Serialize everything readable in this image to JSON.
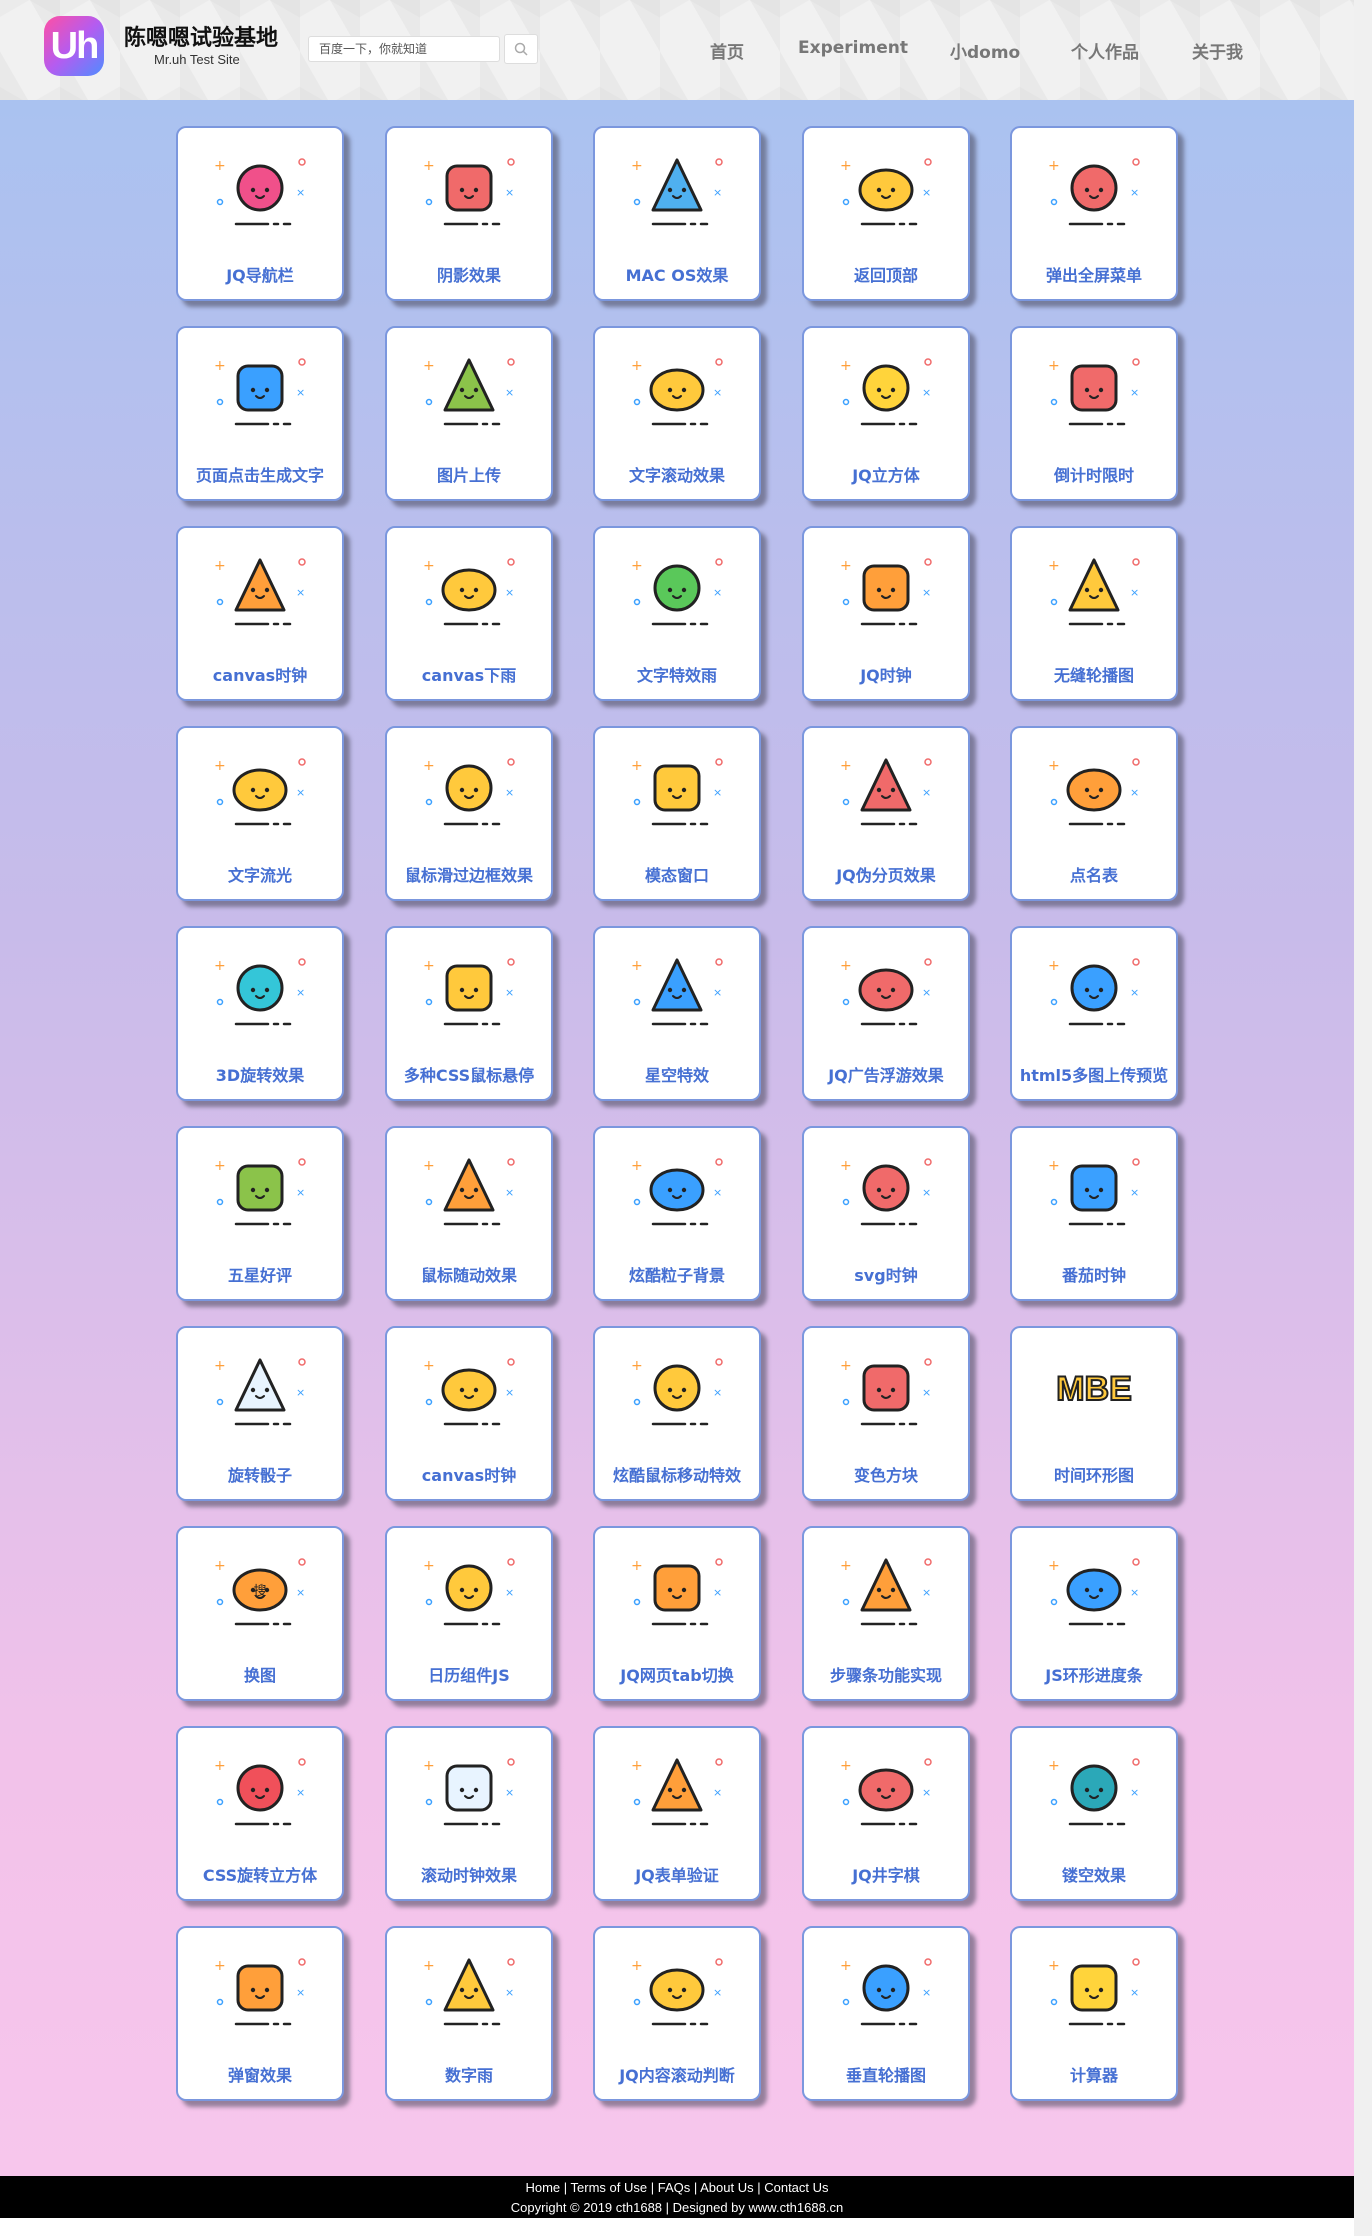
{
  "header": {
    "logo_text": "Uh",
    "site_title": "陈嗯嗯试验基地",
    "site_subtitle": "Mr.uh Test Site",
    "search_placeholder": "百度一下，你就知道",
    "nav": [
      "首页",
      "Experiment",
      "小domo",
      "个人作品",
      "关于我"
    ]
  },
  "cards": [
    {
      "label": "JQ导航栏",
      "icon": "gear-icon",
      "color": "#f0508a"
    },
    {
      "label": "阴影效果",
      "icon": "lock-icon",
      "color": "#f06a6a"
    },
    {
      "label": "MAC OS效果",
      "icon": "ghosts-icon",
      "color": "#4fb0f0"
    },
    {
      "label": "返回顶部",
      "icon": "chat-bubbles-icon",
      "color": "#ffc93c"
    },
    {
      "label": "弹出全屏菜单",
      "icon": "hat-icon",
      "color": "#f06a6a"
    },
    {
      "label": "页面点击生成文字",
      "icon": "speech-bubble-icon",
      "color": "#3aa0ff"
    },
    {
      "label": "图片上传",
      "icon": "shield-icon",
      "color": "#8bc34a"
    },
    {
      "label": "文字滚动效果",
      "icon": "fire-icon",
      "color": "#ffc93c"
    },
    {
      "label": "JQ立方体",
      "icon": "lightning-icon",
      "color": "#ffd43b"
    },
    {
      "label": "倒计时限时",
      "icon": "money-bag-icon",
      "color": "#f06a6a"
    },
    {
      "label": "canvas时钟",
      "icon": "blob-face-icon",
      "color": "#ff9f3a"
    },
    {
      "label": "canvas下雨",
      "icon": "bear-icon",
      "color": "#ffc93c"
    },
    {
      "label": "文字特效雨",
      "icon": "gift-icon",
      "color": "#5ac85a"
    },
    {
      "label": "JQ时钟",
      "icon": "hand-truck-icon",
      "color": "#ff9f3a"
    },
    {
      "label": "无缝轮播图",
      "icon": "truck-icon",
      "color": "#ffc93c"
    },
    {
      "label": "文字流光",
      "icon": "star-icon",
      "color": "#ffc93c"
    },
    {
      "label": "鼠标滑过边框效果",
      "icon": "beer-mug-icon",
      "color": "#ffc93c"
    },
    {
      "label": "模态窗口",
      "icon": "gameboy-icon",
      "color": "#ffc93c"
    },
    {
      "label": "JQ伪分页效果",
      "icon": "bell-icon",
      "color": "#f06a6a"
    },
    {
      "label": "点名表",
      "icon": "box-arrow-icon",
      "color": "#ff9f3a"
    },
    {
      "label": "3D旋转效果",
      "icon": "bell-icon",
      "color": "#34c6d8"
    },
    {
      "label": "多种CSS鼠标悬停",
      "icon": "bell-icon",
      "color": "#ffc93c"
    },
    {
      "label": "星空特效",
      "icon": "popsicle-icon",
      "color": "#3aa0ff"
    },
    {
      "label": "JQ广告浮游效果",
      "icon": "girl-icon",
      "color": "#f06a6a"
    },
    {
      "label": "html5多图上传预览",
      "icon": "clipboard-icon",
      "color": "#3aa0ff"
    },
    {
      "label": "五星好评",
      "icon": "wifi-icon",
      "color": "#8bc34a"
    },
    {
      "label": "鼠标随动效果",
      "icon": "cards-icon",
      "color": "#ff9f3a"
    },
    {
      "label": "炫酷粒子背景",
      "icon": "ice-cream-icon",
      "color": "#3aa0ff"
    },
    {
      "label": "svg时钟",
      "icon": "sack-icon",
      "color": "#f06a6a"
    },
    {
      "label": "番茄时钟",
      "icon": "ship-icon",
      "color": "#3aa0ff"
    },
    {
      "label": "旋转骰子",
      "icon": "cloud-icon",
      "color": "#e8f4ff"
    },
    {
      "label": "canvas时钟",
      "icon": "burger-icon",
      "color": "#ffc93c"
    },
    {
      "label": "炫酷鼠标移动特效",
      "icon": "lightbulb-icon",
      "color": "#ffc93c"
    },
    {
      "label": "变色方块",
      "icon": "sleigh-icon",
      "color": "#f06a6a"
    },
    {
      "label": "时间环形图",
      "icon": "mbe-logo-icon",
      "color": "#ffc93c",
      "logo_text": "MBE"
    },
    {
      "label": "换图",
      "icon": "magnifier-icon",
      "color": "#ff9f3a",
      "glyph": "搜"
    },
    {
      "label": "日历组件JS",
      "icon": "photos-icon",
      "color": "#ffc93c"
    },
    {
      "label": "JQ网页tab切换",
      "icon": "pencils-icon",
      "color": "#ff9f3a"
    },
    {
      "label": "步骤条功能实现",
      "icon": "cart-icon",
      "color": "#ff9f3a"
    },
    {
      "label": "JS环形进度条",
      "icon": "airplane-icon",
      "color": "#3aa0ff"
    },
    {
      "label": "CSS旋转立方体",
      "icon": "heart-icon",
      "color": "#f0505a"
    },
    {
      "label": "滚动时钟效果",
      "icon": "storm-cloud-icon",
      "color": "#e8f4ff"
    },
    {
      "label": "JQ表单验证",
      "icon": "forklift-icon",
      "color": "#ff9f3a"
    },
    {
      "label": "JQ井字棋",
      "icon": "santa-icon",
      "color": "#f06a6a"
    },
    {
      "label": "镂空效果",
      "icon": "sock-icon",
      "color": "#2ba8b8"
    },
    {
      "label": "弹窗效果",
      "icon": "trash-icon",
      "color": "#ff9f3a"
    },
    {
      "label": "数字雨",
      "icon": "sun-cloud-icon",
      "color": "#ffc93c"
    },
    {
      "label": "JQ内容滚动判断",
      "icon": "sunset-icon",
      "color": "#ffc93c"
    },
    {
      "label": "垂直轮播图",
      "icon": "barber-pole-icon",
      "color": "#3aa0ff"
    },
    {
      "label": "计算器",
      "icon": "banana-icon",
      "color": "#ffd43b"
    }
  ],
  "footer": {
    "links": [
      "Home",
      "Terms of Use",
      "FAQs",
      "About Us",
      "Contact Us"
    ],
    "copyright": "Copyright © 2019 cth1688 | Designed by www.cth1688.cn"
  }
}
